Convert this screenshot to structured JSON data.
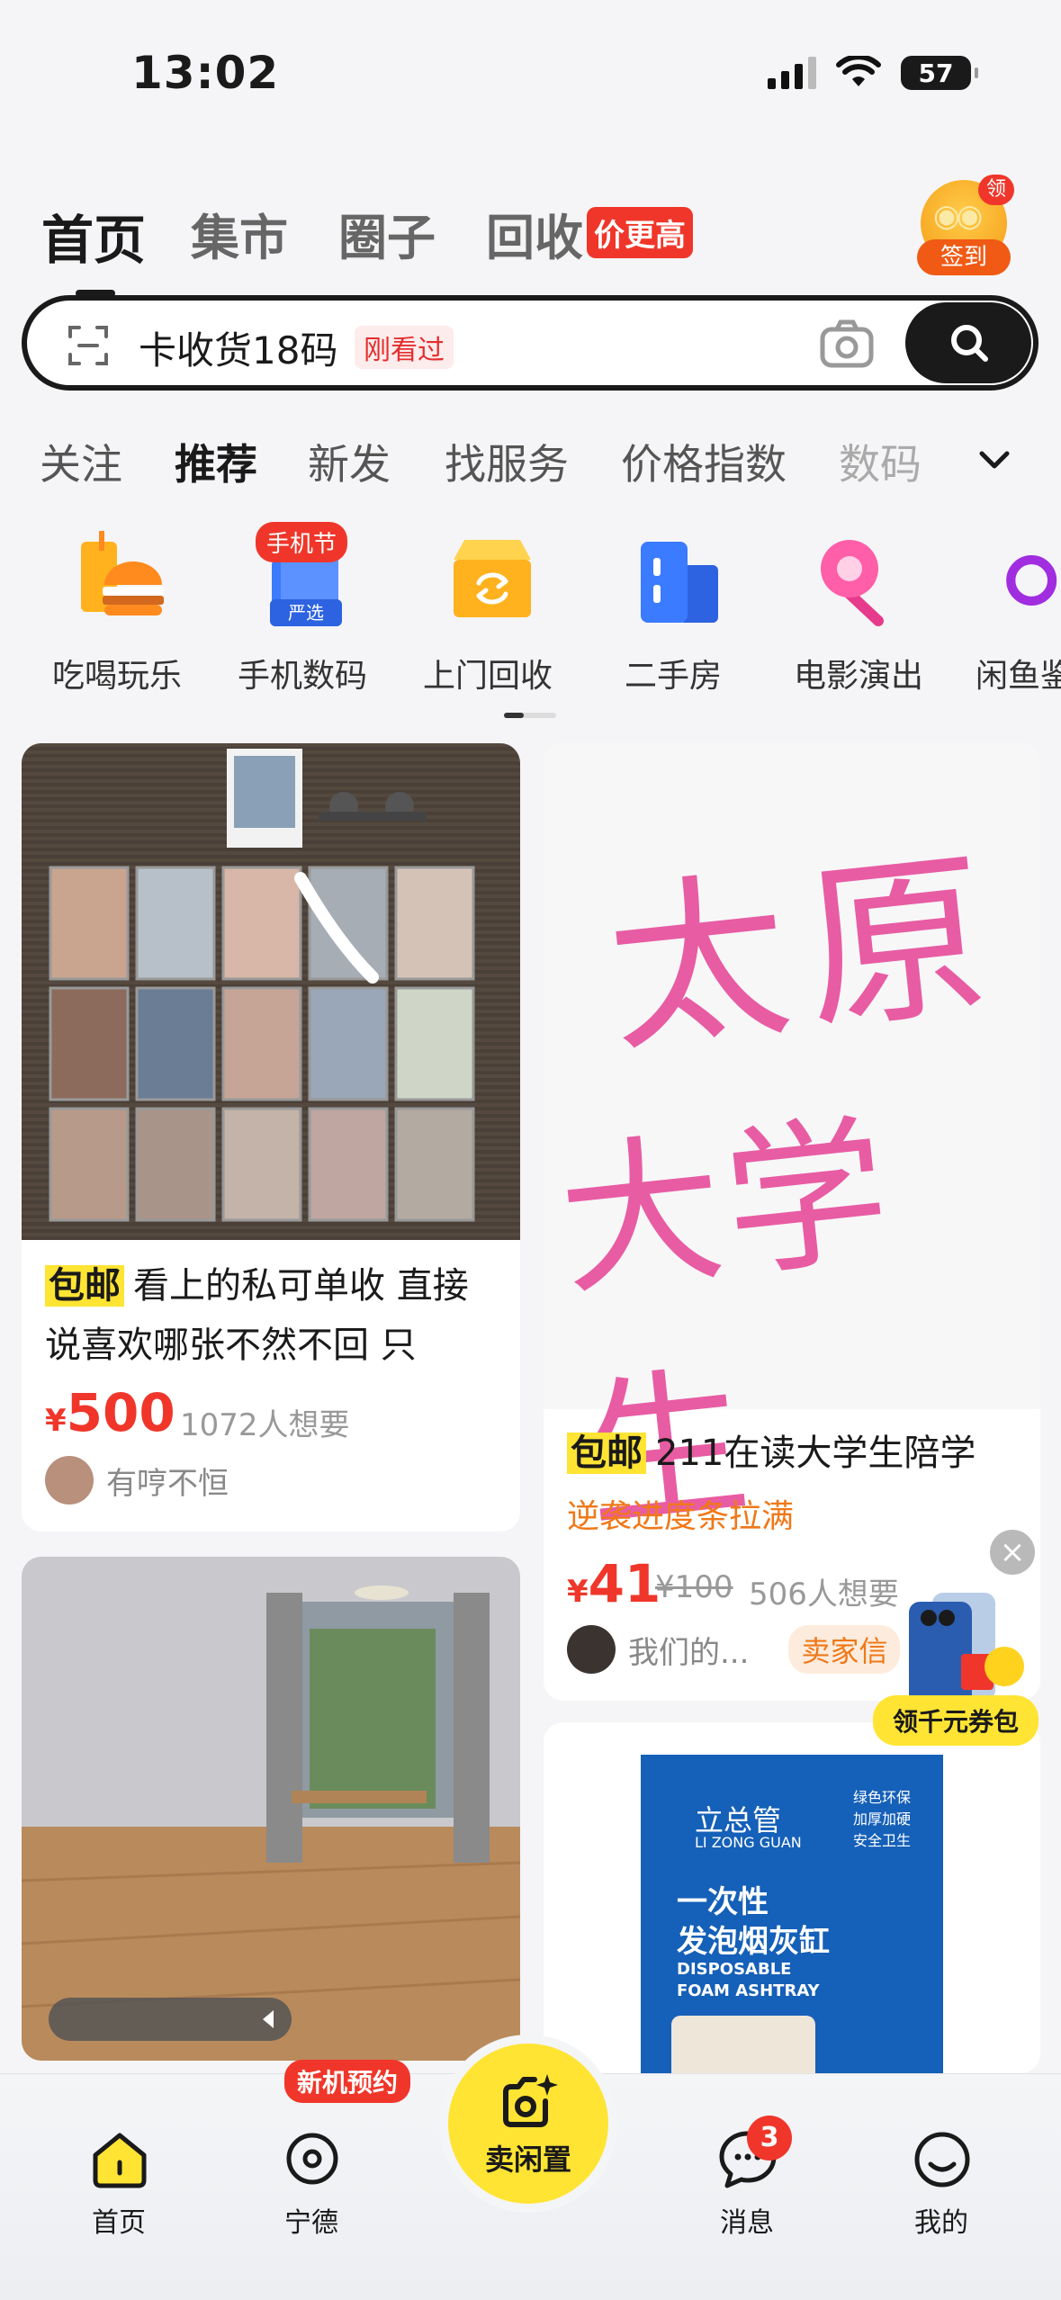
{
  "status_bar": {
    "time": "13:02",
    "battery": "57"
  },
  "top_nav": {
    "tabs": [
      {
        "label": "首页"
      },
      {
        "label": "集市"
      },
      {
        "label": "圈子"
      },
      {
        "label": "回收"
      }
    ],
    "recycle_badge": "价更高",
    "signin_corner": "领",
    "signin_label": "签到"
  },
  "search": {
    "query": "卡收货18码",
    "tag": "刚看过"
  },
  "category_tabs": [
    "关注",
    "推荐",
    "新发",
    "找服务",
    "价格指数",
    "数码"
  ],
  "entries": [
    {
      "label": "吃喝玩乐",
      "icon": "burger-drink-icon"
    },
    {
      "label": "手机数码",
      "icon": "phone-digital-icon",
      "badge": "手机节",
      "sub": "严选"
    },
    {
      "label": "上门回收",
      "icon": "recycle-box-icon"
    },
    {
      "label": "二手房",
      "icon": "building-icon"
    },
    {
      "label": "电影演出",
      "icon": "lollipop-icon"
    },
    {
      "label": "闲鱼鉴",
      "icon": "ring-icon"
    }
  ],
  "cards": {
    "left1": {
      "tag": "包邮",
      "title": "看上的私可单收 直接说喜欢哪张不然不回 只",
      "price_symbol": "¥",
      "price": "500",
      "want": "1072人想要",
      "seller": "有哼不恒"
    },
    "right1": {
      "image_text_line1": "太原",
      "image_text_line2": "大学生",
      "tag": "包邮",
      "title": "211在读大学生陪学",
      "subtitle": "逆袭进度条拉满",
      "price_symbol": "¥",
      "price": "41",
      "original_price": "¥100",
      "want": "506人想要",
      "seller": "我们的...",
      "seller_badge": "卖家信"
    },
    "right2": {
      "brand": "立总管",
      "brand_en": "LI ZONG GUAN",
      "product_line1": "一次性",
      "product_line2": "发泡烟灰缸",
      "product_en1": "DISPOSABLE",
      "product_en2": "FOAM ASHTRAY",
      "features": [
        "绿色环保",
        "加厚加硬",
        "安全卫生"
      ]
    }
  },
  "coupon": {
    "label": "领千元券包",
    "close": "×"
  },
  "tabbar": {
    "tabs": [
      {
        "label": "首页"
      },
      {
        "label": "宁德"
      },
      {
        "label": "卖闲置"
      },
      {
        "label": "消息"
      },
      {
        "label": "我的"
      }
    ],
    "new_badge": "新机预约",
    "message_count": "3"
  },
  "colors": {
    "brand_yellow": "#ffe433",
    "price_red": "#f0362a",
    "dark": "#1a1a1a"
  }
}
